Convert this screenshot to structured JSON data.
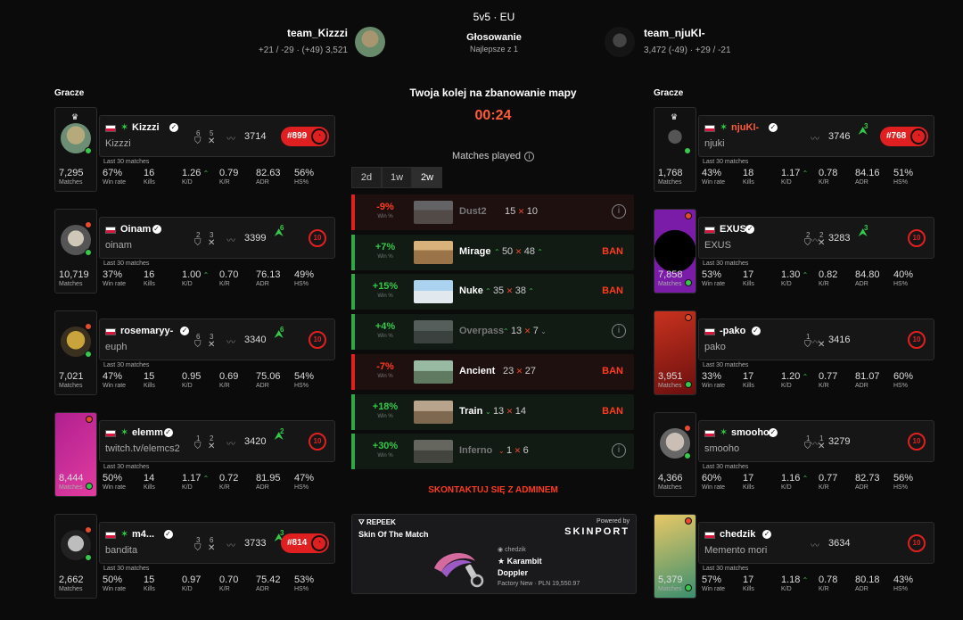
{
  "header": {
    "mode": "5v5 · EU",
    "phase": "Głosowanie",
    "format": "Najlepsze z 1",
    "team_left": {
      "name": "team_Kizzzi",
      "stats": "+21 / -29 · (+49) 3,521"
    },
    "team_right": {
      "name": "team_njuKI-",
      "stats": "3,472 (-49) · +29 / -21"
    }
  },
  "sections": {
    "left": "Gracze",
    "right": "Gracze"
  },
  "veto": {
    "title": "Twoja kolej na zbanowanie mapy",
    "timer": "00:24"
  },
  "stats_caption": "Last 30 matches",
  "stat_labels": {
    "matches": "Matches",
    "winrate": "Win rate",
    "kills": "Kills",
    "kd": "K/D",
    "kr": "K/R",
    "adr": "ADR",
    "hs": "HS%"
  },
  "players_left": [
    {
      "name": "Kizzzi",
      "sub": "Kizzzi",
      "rec_a": "6",
      "rec_b": "5",
      "elo": "3714",
      "rank": "#899",
      "matches": "7,295",
      "winrate": "67%",
      "kills": "16",
      "kd": "1.26",
      "kr": "0.79",
      "adr": "82.63",
      "hs": "56%"
    },
    {
      "name": "Oinam",
      "sub": "oinam",
      "rec_a": "2",
      "rec_b": "3",
      "elo": "3399",
      "lvl_up": "6",
      "level": "10",
      "matches": "10,719",
      "winrate": "37%",
      "kills": "16",
      "kd": "1.00",
      "kr": "0.70",
      "adr": "76.13",
      "hs": "49%"
    },
    {
      "name": "rosemaryy-",
      "sub": "euph",
      "rec_a": "6",
      "rec_b": "3",
      "elo": "3340",
      "lvl_up": "6",
      "level": "10",
      "matches": "7,021",
      "winrate": "47%",
      "kills": "15",
      "kd": "0.95",
      "kr": "0.69",
      "adr": "75.06",
      "hs": "54%"
    },
    {
      "name": "elemm",
      "sub": "twitch.tv/elemcs2",
      "rec_a": "1",
      "rec_b": "2",
      "elo": "3420",
      "lvl_up": "2",
      "level": "10",
      "matches": "8,444",
      "winrate": "50%",
      "kills": "14",
      "kd": "1.17",
      "kr": "0.72",
      "adr": "81.95",
      "hs": "47%"
    },
    {
      "name": "m4...",
      "sub": "bandita",
      "rec_a": "3",
      "rec_b": "6",
      "elo": "3733",
      "lvl_up": "3",
      "rank": "#814",
      "matches": "2,662",
      "winrate": "50%",
      "kills": "15",
      "kd": "0.97",
      "kr": "0.70",
      "adr": "75.42",
      "hs": "53%"
    }
  ],
  "players_right": [
    {
      "name": "njuKI-",
      "sub": "njuki",
      "elo": "3746",
      "lvl_up": "3",
      "rank": "#768",
      "matches": "1,768",
      "winrate": "43%",
      "kills": "18",
      "kd": "1.17",
      "kr": "0.78",
      "adr": "84.16",
      "hs": "51%"
    },
    {
      "name": "EXUS",
      "sub": "EXUS",
      "rec_a": "2",
      "rec_b": "2",
      "elo": "3283",
      "lvl_up": "3",
      "level": "10",
      "matches": "7,858",
      "winrate": "53%",
      "kills": "17",
      "kd": "1.30",
      "kr": "0.82",
      "adr": "84.80",
      "hs": "40%"
    },
    {
      "name": "-pako",
      "sub": "pako",
      "rec_a": "1",
      "elo": "3416",
      "level": "10",
      "matches": "3,951",
      "winrate": "33%",
      "kills": "17",
      "kd": "1.20",
      "kr": "0.77",
      "adr": "81.07",
      "hs": "60%"
    },
    {
      "name": "smooho",
      "sub": "smooho",
      "rec_a": "1",
      "rec_b": "1",
      "elo": "3279",
      "level": "10",
      "matches": "4,366",
      "winrate": "60%",
      "kills": "17",
      "kd": "1.16",
      "kr": "0.77",
      "adr": "82.73",
      "hs": "56%"
    },
    {
      "name": "chedzik",
      "sub": "Memento mori",
      "elo": "3634",
      "level": "10",
      "matches": "5,379",
      "winrate": "57%",
      "kills": "17",
      "kd": "1.18",
      "kr": "0.78",
      "adr": "80.18",
      "hs": "43%"
    }
  ],
  "maps_panel": {
    "title": "Matches played",
    "tabs": [
      "2d",
      "1w",
      "2w"
    ],
    "active_tab": "2w",
    "winpct_label": "Win %",
    "ban_label": "BAN",
    "maps": [
      {
        "name": "Dust2",
        "winpct": "-9%",
        "score_a": "15",
        "score_b": "10",
        "banned": true
      },
      {
        "name": "Mirage",
        "winpct": "+7%",
        "score_a": "50",
        "score_b": "48",
        "banned": false
      },
      {
        "name": "Nuke",
        "winpct": "+15%",
        "score_a": "35",
        "score_b": "38",
        "banned": false
      },
      {
        "name": "Overpass",
        "winpct": "+4%",
        "score_a": "13",
        "score_b": "7",
        "banned": true
      },
      {
        "name": "Ancient",
        "winpct": "-7%",
        "score_a": "23",
        "score_b": "27",
        "banned": false
      },
      {
        "name": "Train",
        "winpct": "+18%",
        "score_a": "13",
        "score_b": "14",
        "banned": false
      },
      {
        "name": "Inferno",
        "winpct": "+30%",
        "score_a": "1",
        "score_b": "6",
        "banned": true
      }
    ]
  },
  "contact_admin": "SKONTAKTUJ SIĘ Z ADMINEM",
  "skin_card": {
    "brand": "REPEEK",
    "title": "Skin Of The Match",
    "powered": "Powered by",
    "sponsor": "SKINPORT",
    "owner": "chedzik",
    "item_line1": "★ Karambit",
    "item_line2": "Doppler",
    "condition": "Factory New · PLN 19,550.97"
  },
  "colors": {
    "accent": "#ff5a3a",
    "win": "#36c84a",
    "loss": "#e02020"
  }
}
